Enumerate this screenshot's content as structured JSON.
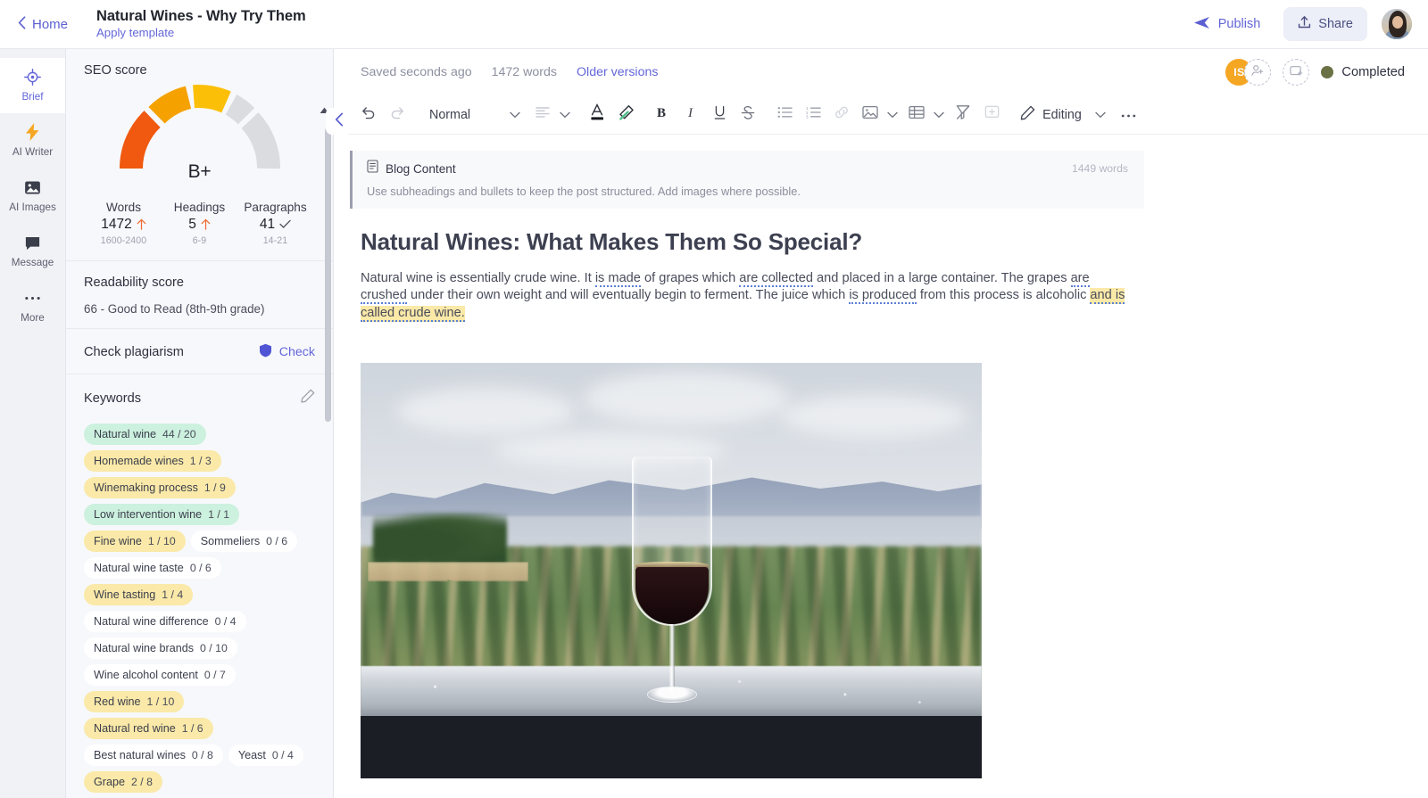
{
  "topbar": {
    "home_label": "Home",
    "back_icon": "chevron-left-icon",
    "doc_title": "Natural Wines - Why Try Them",
    "apply_template": "Apply template",
    "publish_label": "Publish",
    "publish_icon": "send-icon",
    "share_label": "Share",
    "share_icon": "upload-icon",
    "avatar_alt": "user-avatar"
  },
  "rail": {
    "items": [
      {
        "label": "Brief",
        "icon": "target-icon",
        "active": true
      },
      {
        "label": "AI Writer",
        "icon": "bolt-icon",
        "active": false
      },
      {
        "label": "AI Images",
        "icon": "image-icon",
        "active": false
      },
      {
        "label": "Message",
        "icon": "chat-icon",
        "active": false
      },
      {
        "label": "More",
        "icon": "ellipsis-icon",
        "active": false
      }
    ]
  },
  "seo_panel": {
    "seo_score_title": "SEO score",
    "grade": "B+",
    "metrics": [
      {
        "name": "Words",
        "value": "1472",
        "indicator": "up",
        "range": "1600-2400"
      },
      {
        "name": "Headings",
        "value": "5",
        "indicator": "up",
        "range": "6-9"
      },
      {
        "name": "Paragraphs",
        "value": "41",
        "indicator": "check",
        "range": "14-21"
      }
    ],
    "readability_title": "Readability score",
    "readability_text": "66 - Good to Read (8th-9th grade)",
    "plagiarism_title": "Check plagiarism",
    "plagiarism_action": "Check",
    "plagiarism_icon": "shield-icon",
    "keywords_title": "Keywords",
    "keywords_edit_icon": "pencil-icon",
    "keywords": [
      {
        "term": "Natural wine",
        "count": "44 / 20",
        "state": "green"
      },
      {
        "term": "Homemade wines",
        "count": "1 / 3",
        "state": "yellow"
      },
      {
        "term": "Winemaking process",
        "count": "1 / 9",
        "state": "yellow"
      },
      {
        "term": "Low intervention wine",
        "count": "1 / 1",
        "state": "green"
      },
      {
        "term": "Fine wine",
        "count": "1 / 10",
        "state": "yellow"
      },
      {
        "term": "Sommeliers",
        "count": "0 / 6",
        "state": "white"
      },
      {
        "term": "Natural wine taste",
        "count": "0 / 6",
        "state": "white"
      },
      {
        "term": "Wine tasting",
        "count": "1 / 4",
        "state": "yellow"
      },
      {
        "term": "Natural wine difference",
        "count": "0 / 4",
        "state": "white"
      },
      {
        "term": "Natural wine brands",
        "count": "0 / 10",
        "state": "white"
      },
      {
        "term": "Wine alcohol content",
        "count": "0 / 7",
        "state": "white"
      },
      {
        "term": "Red wine",
        "count": "1 / 10",
        "state": "yellow"
      },
      {
        "term": "Natural red wine",
        "count": "1 / 6",
        "state": "yellow"
      },
      {
        "term": "Best natural wines",
        "count": "0 / 8",
        "state": "white"
      },
      {
        "term": "Yeast",
        "count": "0 / 4",
        "state": "white"
      },
      {
        "term": "Grape",
        "count": "2 / 8",
        "state": "yellow"
      }
    ],
    "collapse_icon": "chevron-left-icon",
    "scroll_up_icon": "caret-up-icon"
  },
  "editor": {
    "saved_status": "Saved seconds ago",
    "word_count": "1472 words",
    "older_versions": "Older versions",
    "collaborator_initials": "IS",
    "add_person_icon": "add-person-icon",
    "add_asset_icon": "add-media-icon",
    "status_label": "Completed",
    "status_color": "#6b7145",
    "toolbar": {
      "undo_icon": "undo-icon",
      "redo_icon": "redo-icon",
      "style_label": "Normal",
      "style_caret_icon": "chevron-down-icon",
      "align_icon": "align-left-icon",
      "align_caret_icon": "chevron-down-icon",
      "text_color_icon": "text-color-icon",
      "highlight_icon": "highlighter-icon",
      "bold_icon": "bold-icon",
      "italic_icon": "italic-icon",
      "underline_icon": "underline-icon",
      "strikethrough_icon": "strikethrough-icon",
      "bullet_list_icon": "bullet-list-icon",
      "numbered_list_icon": "numbered-list-icon",
      "link_icon": "link-icon",
      "image_icon": "image-icon",
      "image_caret_icon": "chevron-down-icon",
      "table_icon": "table-icon",
      "table_caret_icon": "chevron-down-icon",
      "clear_format_icon": "clear-format-icon",
      "add_block_icon": "add-block-icon",
      "mode_icon": "pencil-icon",
      "mode_label": "Editing",
      "mode_caret_icon": "chevron-down-icon",
      "more_icon": "ellipsis-icon"
    }
  },
  "document": {
    "block_icon": "document-icon",
    "block_title": "Blog Content",
    "block_word_count": "1449 words",
    "block_hint": "Use subheadings and bullets to keep the post structured. Add images where possible.",
    "heading": "Natural Wines: What Makes Them So Special?",
    "paragraph": {
      "seg1": "Natural wine is essentially crude wine. It ",
      "seg2_gram": "is made",
      "seg3": " of grapes which ",
      "seg4_gram": "are collected",
      "seg5": " and placed in a large container. The grapes ",
      "seg6_gram": "are crushed",
      "seg7": " under their own weight and will eventually begin to ferment. The juice which ",
      "seg8_gram": "is produced",
      "seg9": " from this process is alcoholic ",
      "seg10_hl": "and is called crude wine."
    },
    "image_alt": "wine-glass-vineyard-photo"
  }
}
